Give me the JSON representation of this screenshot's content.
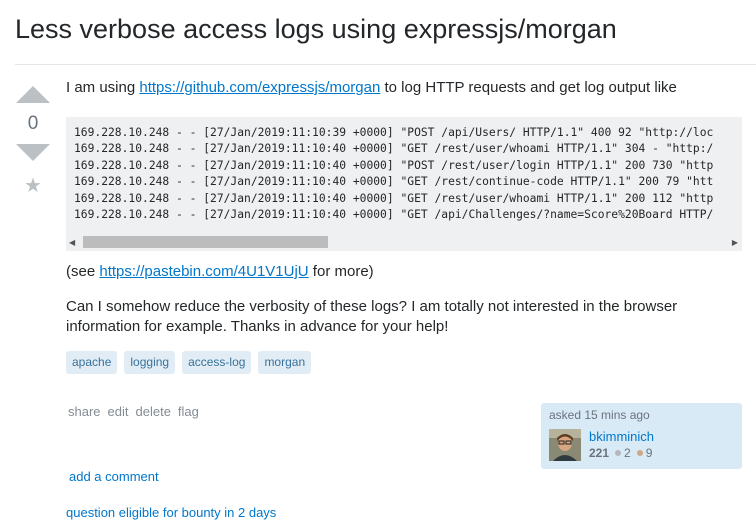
{
  "question": {
    "title": "Less verbose access logs using expressjs/morgan",
    "vote_count": "0",
    "intro_text": "I am using ",
    "intro_link": "https://github.com/expressjs/morgan",
    "intro_suffix": " to log HTTP requests and get log output like",
    "code_lines": [
      "169.228.10.248 - - [27/Jan/2019:11:10:39 +0000] \"POST /api/Users/ HTTP/1.1\" 400 92 \"http://loc",
      "169.228.10.248 - - [27/Jan/2019:11:10:40 +0000] \"GET /rest/user/whoami HTTP/1.1\" 304 - \"http:/",
      "169.228.10.248 - - [27/Jan/2019:11:10:40 +0000] \"POST /rest/user/login HTTP/1.1\" 200 730 \"http",
      "169.228.10.248 - - [27/Jan/2019:11:10:40 +0000] \"GET /rest/continue-code HTTP/1.1\" 200 79 \"htt",
      "169.228.10.248 - - [27/Jan/2019:11:10:40 +0000] \"GET /rest/user/whoami HTTP/1.1\" 200 112 \"http",
      "169.228.10.248 - - [27/Jan/2019:11:10:40 +0000] \"GET /api/Challenges/?name=Score%20Board HTTP/"
    ],
    "see_prefix": "(see ",
    "see_link": "https://pastebin.com/4U1V1UjU",
    "see_suffix": " for more)",
    "body_text": "Can I somehow reduce the verbosity of these logs? I am totally not interested in the browser information for example. Thanks in advance for your help!",
    "tags": [
      "apache",
      "logging",
      "access-log",
      "morgan"
    ]
  },
  "post_menu": {
    "share": "share",
    "edit": "edit",
    "delete": "delete",
    "flag": "flag"
  },
  "owner": {
    "asked": "asked 15 mins ago",
    "name": "bkimminich",
    "reputation": "221",
    "silver_badges": "2",
    "bronze_badges": "9"
  },
  "links": {
    "add_comment": "add a comment",
    "bounty": "question eligible for bounty in 2 days"
  },
  "icons": {
    "upvote": "upvote-arrow-icon",
    "downvote": "downvote-arrow-icon",
    "favorite": "star-icon"
  }
}
